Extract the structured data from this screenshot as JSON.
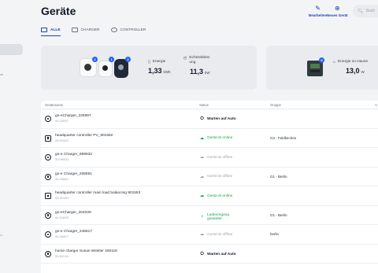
{
  "sidebar": {
    "partial_text": "m"
  },
  "header": {
    "title": "Geräte",
    "actions": [
      {
        "icon": "pencil-icon",
        "label": "Bearbeiten"
      },
      {
        "icon": "plus-circle-icon",
        "label": "Neues Gerät"
      }
    ],
    "search_placeholder": "Such"
  },
  "tabs": [
    {
      "icon": "devices-icon",
      "label": "ALLE",
      "active": true
    },
    {
      "icon": "charger-icon",
      "label": "CHARGER",
      "active": false
    },
    {
      "icon": "controller-icon",
      "label": "CONTROLLER",
      "active": false
    }
  ],
  "summary": {
    "charger_badges": [
      "2",
      "1",
      "2"
    ],
    "energy": {
      "icon": "battery-icon",
      "label": "Energie",
      "value": "1,33",
      "unit": "kWh"
    },
    "power": {
      "icon": "gauge-icon",
      "label": "Echtzeitleist ung",
      "value": "11,3",
      "unit": "kW"
    },
    "home": {
      "badge": "5",
      "icon": "home-icon",
      "label": "Energie zu Hause",
      "value": "13,0",
      "unit": "W"
    }
  },
  "table": {
    "columns": [
      "Gerätename",
      "Status",
      "Gruppe",
      "A"
    ],
    "rows": [
      {
        "type": "charger",
        "name": "go-eCharger_225997",
        "sn": "SN 225997",
        "status": "Warten auf Auto",
        "status_kind": "wait",
        "group": ""
      },
      {
        "type": "controller",
        "name": "headquarter controller PV_901552",
        "sn": "SN 901552",
        "status": "Gerät ist online",
        "status_kind": "online",
        "group": "G3 - Feldkirchen"
      },
      {
        "type": "charger",
        "name": "go-e Charger_999933",
        "sn": "SN 999933",
        "status": "Gerät ist offline",
        "status_kind": "offline",
        "group": ""
      },
      {
        "type": "charger",
        "name": "go-e Charger_206851",
        "sn": "SN 206851",
        "status": "Gerät ist offline",
        "status_kind": "offline",
        "group": "G1 - Berlin"
      },
      {
        "type": "controller",
        "name": "headquarter controller main load balancing 901553",
        "sn": "SN 901553",
        "status": "Gerät ist online",
        "status_kind": "online",
        "group": ""
      },
      {
        "type": "charger",
        "name": "go-eCharger_204039",
        "sn": "SN 204039",
        "status": "Ladevorgang gestartet",
        "status_kind": "charging",
        "group": "G1 - Berlin"
      },
      {
        "type": "charger",
        "name": "go-e Charger_246817",
        "sn": "SN 246817",
        "status": "Gerät ist offline",
        "status_kind": "offline",
        "group": "berlin"
      },
      {
        "type": "charger",
        "name": "home charger Susan Winkler 400116",
        "sn": "SN 400116",
        "status": "Warten auf Auto",
        "status_kind": "wait",
        "group": ""
      }
    ]
  }
}
